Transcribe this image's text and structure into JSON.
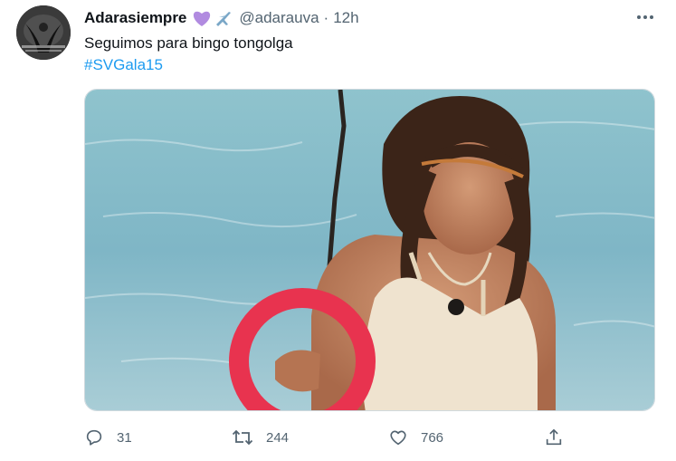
{
  "tweet": {
    "display_name": "Adarasiempre",
    "name_emojis": [
      "purple-heart-icon",
      "airplane-icon"
    ],
    "handle": "@adarauva",
    "separator": "·",
    "time": "12h",
    "text": "Seguimos para bingo tongolga",
    "hashtag": "#SVGala15"
  },
  "actions": {
    "replies": "31",
    "retweets": "244",
    "likes": "766"
  },
  "colors": {
    "link": "#1d9bf0",
    "secondary_text": "#536471",
    "circle_annotation": "#e8334f"
  }
}
